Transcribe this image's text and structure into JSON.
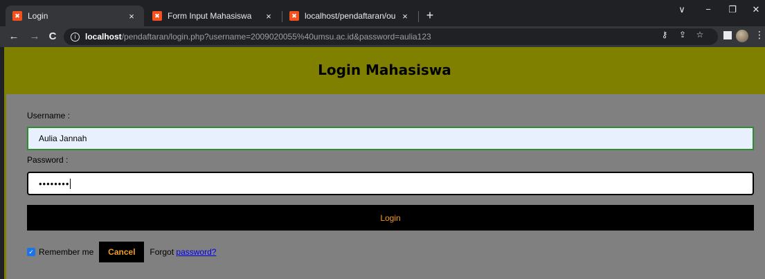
{
  "browser": {
    "tabs": [
      {
        "title": "Login",
        "favicon": "xampp-icon",
        "active": true
      },
      {
        "title": "Form Input Mahasiswa",
        "favicon": "xampp-icon",
        "active": false
      },
      {
        "title": "localhost/pendaftaran/output.ph",
        "favicon": "xampp-icon",
        "active": false
      }
    ],
    "tab_close": "×",
    "new_tab": "+",
    "window_controls": {
      "dropdown": "∨",
      "minimize": "−",
      "restore": "❐",
      "close": "✕"
    },
    "nav": {
      "back": "←",
      "forward": "→",
      "reload": "C"
    },
    "url_host": "localhost",
    "url_path": "/pendaftaran/login.php?username=2009020055%40umsu.ac.id&password=aulia123",
    "toolbar_icons": [
      "key-icon",
      "share-icon",
      "star-icon",
      "sidebar-icon",
      "profile-avatar",
      "menu-icon"
    ]
  },
  "page": {
    "title": "Login Mahasiswa",
    "username_label": "Username :",
    "username_value": "Aulia Jannah",
    "password_label": "Password :",
    "password_masked": "••••••••",
    "login_button": "Login",
    "remember_label": "Remember me",
    "remember_checked": true,
    "cancel_button": "Cancel",
    "forgot_text": "Forgot",
    "forgot_link": "password?"
  },
  "colors": {
    "header_bg": "#808000",
    "form_bg": "#808080",
    "button_bg": "#000000",
    "button_text": "#f29c1f",
    "link": "#0000ee"
  }
}
